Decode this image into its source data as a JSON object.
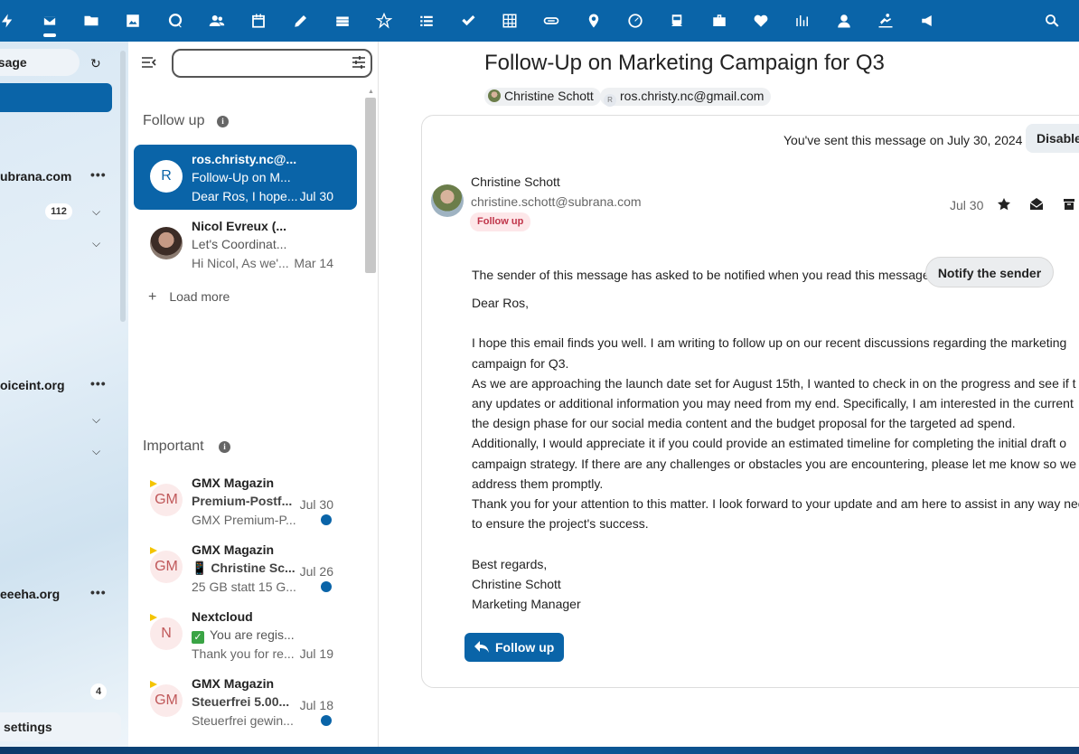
{
  "topbar": {
    "apps": [
      "activity-icon",
      "mail-icon",
      "files-icon",
      "photos-icon",
      "talk-icon",
      "contacts-icon",
      "calendar-icon",
      "notes-icon",
      "deck-icon",
      "forms-icon",
      "tasks-icon",
      "checklist-icon",
      "tables-icon",
      "link-icon",
      "maps-icon",
      "dashboard-icon",
      "transport-icon",
      "bag-icon",
      "health-icon",
      "stocks-icon",
      "user-icon",
      "workout-icon",
      "announcements-icon",
      "search-icon"
    ]
  },
  "leftnav": {
    "new_message": "ssage",
    "accounts": [
      {
        "name": "ubrana.com",
        "count": "112"
      },
      {
        "name": "oiceint.org"
      },
      {
        "name": "eeeha.org",
        "count": "4"
      }
    ],
    "settings": "settings"
  },
  "list": {
    "search": {
      "value": "",
      "placeholder": ""
    },
    "sections": [
      {
        "title": "Follow up"
      },
      {
        "title": "Important"
      }
    ],
    "load_more": "Load more",
    "followup": [
      {
        "initial": "R",
        "from": "ros.christy.nc@...",
        "subject": "Follow-Up on M...",
        "preview": "Dear Ros, I hope...",
        "date": "Jul 30"
      },
      {
        "initial": "",
        "from": "Nicol Evreux (...",
        "subject": "Let's Coordinat...",
        "preview": "Hi Nicol, As we'...",
        "date": "Mar 14"
      }
    ],
    "important": [
      {
        "initial": "GM",
        "from": "GMX Magazin",
        "subject": "Premium-Postf...",
        "preview": "GMX Premium-P...",
        "date": "Jul 30"
      },
      {
        "initial": "GM",
        "from": "GMX Magazin",
        "subject": "📱 Christine Sc...",
        "preview": "25 GB statt 15 G...",
        "date": "Jul 26"
      },
      {
        "initial": "N",
        "from": "Nextcloud",
        "subject": "You are regis...",
        "preview": "Thank you for re...",
        "date": "Jul 19"
      },
      {
        "initial": "GM",
        "from": "GMX Magazin",
        "subject": "Steuerfrei 5.00...",
        "preview": "Steuerfrei gewin...",
        "date": "Jul 18"
      }
    ]
  },
  "message": {
    "subject": "Follow-Up on Marketing Campaign for Q3",
    "recipients": [
      {
        "label": "Christine Schott"
      },
      {
        "initial": "R",
        "label": "ros.christy.nc@gmail.com"
      }
    ],
    "sent_note": "You've sent this message on July 30, 2024",
    "disable_label": "Disable",
    "sender_name": "Christine Schott",
    "sender_email": "christine.schott@subrana.com",
    "tag": "Follow up",
    "date": "Jul 30",
    "notify_text": "The sender of this message has asked to be notified when you read this message.",
    "notify_button": "Notify the sender",
    "body": {
      "greeting": "Dear Ros,",
      "lines": [
        "I hope this email finds you well. I am writing to follow up on our recent discussions regarding the marketing",
        "campaign for Q3.",
        "As we are approaching the launch date set for August 15th, I wanted to check in on the progress and see if t",
        "any updates or additional information you may need from my end. Specifically, I am interested in the current",
        "the design phase for our social media content and the budget proposal for the targeted ad spend.",
        "Additionally, I would appreciate it if you could provide an estimated timeline for completing the initial draft o",
        "campaign strategy. If there are any challenges or obstacles you are encountering, please let me know so we ca",
        "address them promptly.",
        "Thank you for your attention to this matter. I look forward to your update and am here to assist in any way nee",
        "to ensure the project's success."
      ],
      "signoff": [
        "Best regards,",
        "Christine Schott",
        "Marketing Manager"
      ]
    },
    "reply_button": "Follow up"
  }
}
